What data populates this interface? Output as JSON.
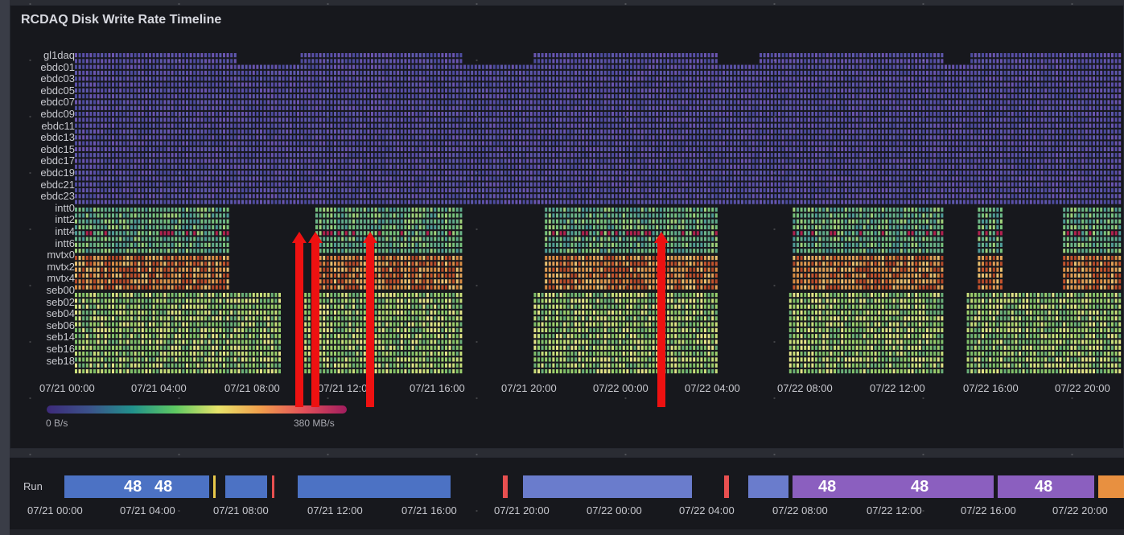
{
  "panel": {
    "title": "RCDAQ Disk Write Rate Timeline",
    "hosts": [
      "gl1daq",
      "ebdc01",
      "ebdc03",
      "ebdc05",
      "ebdc07",
      "ebdc09",
      "ebdc11",
      "ebdc13",
      "ebdc15",
      "ebdc17",
      "ebdc19",
      "ebdc21",
      "ebdc23",
      "intt0",
      "intt2",
      "intt4",
      "intt6",
      "mvtx0",
      "mvtx2",
      "mvtx4",
      "seb00",
      "seb02",
      "seb04",
      "seb06",
      "seb14",
      "seb16",
      "seb18"
    ],
    "x_ticks": [
      "07/21 00:00",
      "07/21 04:00",
      "07/21 08:00",
      "07/21 12:00",
      "07/21 16:00",
      "07/21 20:00",
      "07/22 00:00",
      "07/22 04:00",
      "07/22 08:00",
      "07/22 12:00",
      "07/22 16:00",
      "07/22 20:00"
    ],
    "colorbar": {
      "min_label": "0 B/s",
      "max_label": "380 MB/s"
    }
  },
  "run_panel": {
    "label": "Run",
    "numbers": [
      "48",
      "48",
      "48",
      "48",
      "48"
    ],
    "x_ticks": [
      "07/21 00:00",
      "07/21 04:00",
      "07/21 08:00",
      "07/21 12:00",
      "07/21 16:00",
      "07/21 20:00",
      "07/22 00:00",
      "07/22 04:00",
      "07/22 08:00",
      "07/22 12:00",
      "07/22 16:00",
      "07/22 20:00"
    ]
  },
  "colors": {
    "background": "#17181d",
    "ebdc_low": "#5a4fa8",
    "arrow": "#ee1111",
    "run_blue": "#4c72c4",
    "run_purple": "#8b5fbf"
  }
}
